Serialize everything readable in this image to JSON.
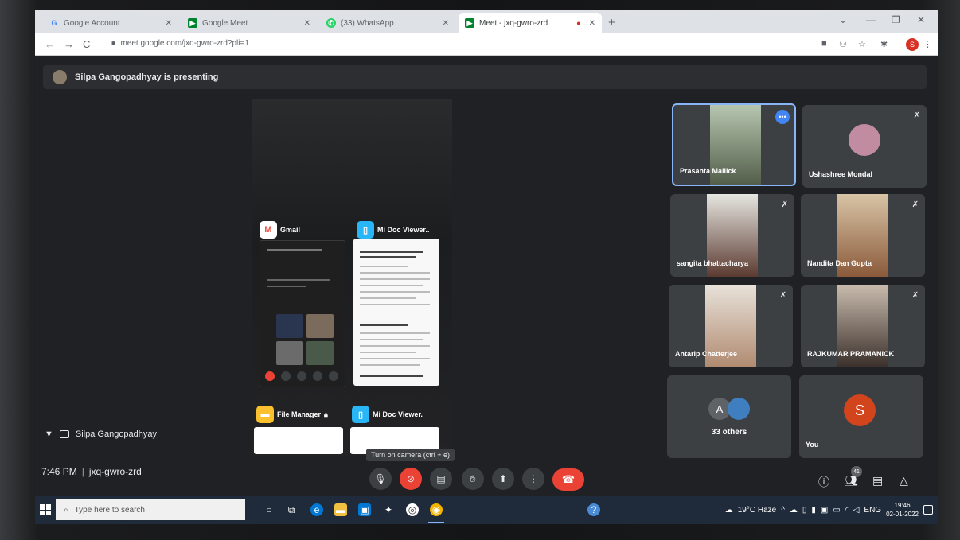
{
  "browser": {
    "tabs": [
      {
        "label": "Google Account",
        "icon": "google-icon",
        "active": false
      },
      {
        "label": "Google Meet",
        "icon": "meet-icon",
        "active": false
      },
      {
        "label": "(33) WhatsApp",
        "icon": "whatsapp-icon",
        "active": false
      },
      {
        "label": "Meet - jxq-gwro-zrd",
        "icon": "meet-icon",
        "active": true
      }
    ],
    "url": "meet.google.com/jxq-gwro-zrd?pli=1",
    "profile_initial": "S"
  },
  "meet": {
    "presenting_banner": "Silpa Gangopadhyay is presenting",
    "presenter_name": "Silpa Gangopadhyay",
    "time": "7:46 PM",
    "meeting_code": "jxq-gwro-zrd",
    "shared_screen": {
      "apps": [
        {
          "name": "Gmail"
        },
        {
          "name": "Mi Doc Viewer.."
        },
        {
          "name": "File Manager"
        },
        {
          "name": "Mi Doc Viewer."
        }
      ]
    },
    "participants": [
      {
        "name": "Prasanta Mallick",
        "muted": false,
        "active": true
      },
      {
        "name": "Ushashree Mondal",
        "muted": true
      },
      {
        "name": "sangita bhattacharya",
        "muted": true
      },
      {
        "name": "Nandita Dan Gupta",
        "muted": true
      },
      {
        "name": "Antarip Chatterjee",
        "muted": true
      },
      {
        "name": "RAJKUMAR PRAMANICK",
        "muted": true
      }
    ],
    "others_label": "33 others",
    "others_initial": "A",
    "you_label": "You",
    "you_initial": "S",
    "tooltip": "Turn on camera (ctrl + e)",
    "people_count": "41"
  },
  "taskbar": {
    "search_placeholder": "Type here to search",
    "weather": "19°C  Haze",
    "language": "ENG",
    "time": "19:46",
    "date": "02-01-2022"
  }
}
